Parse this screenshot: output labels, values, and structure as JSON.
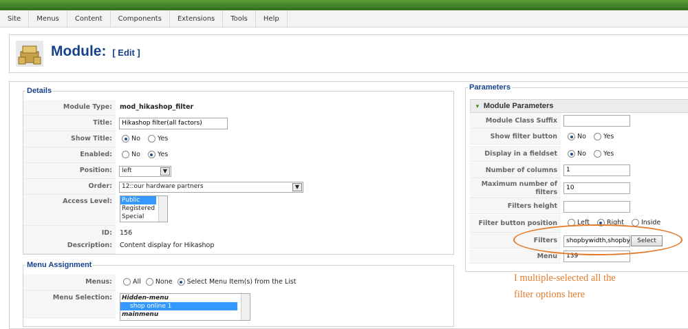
{
  "colors": {
    "accent": "#15428b",
    "annotation": "#e37b2b",
    "topbar": "#3b7d24"
  },
  "menubar": {
    "items": [
      "Site",
      "Menus",
      "Content",
      "Components",
      "Extensions",
      "Tools",
      "Help"
    ]
  },
  "header": {
    "title": "Module:",
    "edit_label": "[ Edit ]",
    "icon": "module-icon"
  },
  "details": {
    "legend": "Details",
    "module_type": {
      "label": "Module Type:",
      "value": "mod_hikashop_filter"
    },
    "title": {
      "label": "Title:",
      "value": "Hikashop filter(all factors)"
    },
    "show_title": {
      "label": "Show Title:",
      "options": [
        "No",
        "Yes"
      ],
      "selected": "No"
    },
    "enabled": {
      "label": "Enabled:",
      "options": [
        "No",
        "Yes"
      ],
      "selected": "Yes"
    },
    "position": {
      "label": "Position:",
      "value": "left"
    },
    "order": {
      "label": "Order:",
      "value": "12::our hardware partners"
    },
    "access": {
      "label": "Access Level:",
      "options": [
        "Public",
        "Registered",
        "Special"
      ],
      "selected": "Public"
    },
    "id": {
      "label": "ID:",
      "value": "156"
    },
    "description": {
      "label": "Description:",
      "value": "Content display for Hikashop"
    }
  },
  "menu_assignment": {
    "legend": "Menu Assignment",
    "menus": {
      "label": "Menus:",
      "options": [
        "All",
        "None",
        "Select Menu Item(s) from the List"
      ],
      "selected": "Select Menu Item(s) from the List"
    },
    "selection": {
      "label": "Menu Selection:",
      "items": [
        "Hidden-menu",
        "shop online 1",
        "mainmenu"
      ]
    }
  },
  "parameters": {
    "legend": "Parameters",
    "panel_title": "Module Parameters",
    "class_suffix": {
      "label": "Module Class Suffix",
      "value": ""
    },
    "show_filter_button": {
      "label": "Show filter button",
      "options": [
        "No",
        "Yes"
      ],
      "selected": "No"
    },
    "display_fieldset": {
      "label": "Display in a fieldset",
      "options": [
        "No",
        "Yes"
      ],
      "selected": "No"
    },
    "num_columns": {
      "label": "Number of columns",
      "value": "1"
    },
    "max_filters": {
      "label_1": "Maximum number of",
      "label_2": "filters",
      "value": "10"
    },
    "filters_height": {
      "label": "Filters height",
      "value": ""
    },
    "filter_button_position": {
      "label": "Filter button position",
      "options": [
        "Left",
        "Right",
        "Inside"
      ],
      "selected": "Right"
    },
    "filters": {
      "label": "Filters",
      "value": "shopbywidth,shopbypr",
      "button": "Select"
    },
    "menu": {
      "label": "Menu",
      "value": "139"
    }
  },
  "annotation": {
    "line1": "I multiple-selected all the",
    "line2": "filter options here"
  }
}
